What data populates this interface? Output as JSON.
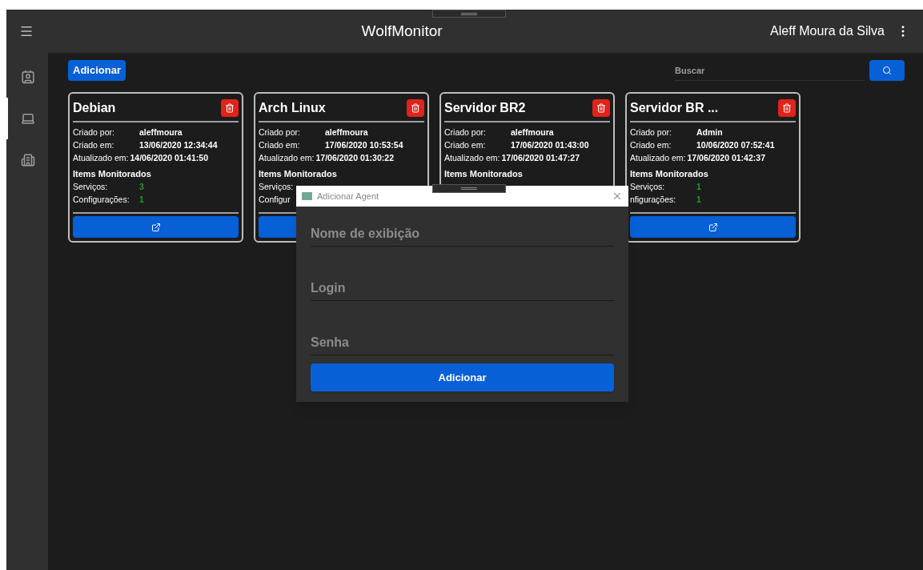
{
  "app": {
    "title": "WolfMonitor",
    "user": "Aleff Moura da Silva"
  },
  "sidebar": {
    "items": [
      {
        "selected": false
      },
      {
        "selected": true
      },
      {
        "selected": false
      }
    ]
  },
  "toolbar": {
    "add_button": "Adicionar",
    "search": {
      "placeholder": "Buscar"
    }
  },
  "cards": [
    {
      "title": "Debian",
      "created_by_label": "Criado por:",
      "created_by": "aleffmoura",
      "created_at_label": "Criado em:",
      "created_at": "13/06/2020 12:34:44",
      "updated_at_label": "Atualizado em:",
      "updated_at": "14/06/2020 01:41:50",
      "section": "Items Monitorados",
      "services_label": "Serviços:",
      "services": "3",
      "configs_label": "Configurações:",
      "configs": "1",
      "open_button": {
        "kind": "icon"
      }
    },
    {
      "title": "Arch Linux",
      "created_by_label": "Criado por:",
      "created_by": "aleffmoura",
      "created_at_label": "Criado em:",
      "created_at": "17/06/2020 10:53:54",
      "updated_at_label": "Atualizado em:",
      "updated_at": "17/06/2020 01:30:22",
      "section": "Items Monitorados",
      "services_label": "Serviços:",
      "configs_label": "Configur",
      "open_button": {
        "kind": "plain"
      }
    },
    {
      "title": "Servidor BR2",
      "created_by_label": "Criado por:",
      "created_by": "aleffmoura",
      "created_at_label": "Criado em:",
      "created_at": "17/06/2020 01:43:00",
      "updated_at_label": "Atualizado em:",
      "updated_at": "17/06/2020 01:47:27",
      "section": "Items Monitorados"
    },
    {
      "title": "Servidor BR ...",
      "created_by_label": "Criado por:",
      "created_by": "Admin",
      "created_at_label": "Criado em:",
      "created_at": "10/06/2020 07:52:41",
      "updated_at_label": "Atualizado em:",
      "updated_at": "17/06/2020 01:42:37",
      "section": "Items Monitorados",
      "services_label": "Serviços:",
      "services": "1",
      "configs_label": "nfigurações:",
      "configs": "1",
      "open_button": {
        "kind": "icon"
      }
    }
  ],
  "dialog": {
    "title": "Adicionar Agent",
    "fields": [
      {
        "placeholder": "Nome de exibição"
      },
      {
        "placeholder": "Login"
      },
      {
        "placeholder": "Senha"
      }
    ],
    "submit": "Adicionar"
  }
}
